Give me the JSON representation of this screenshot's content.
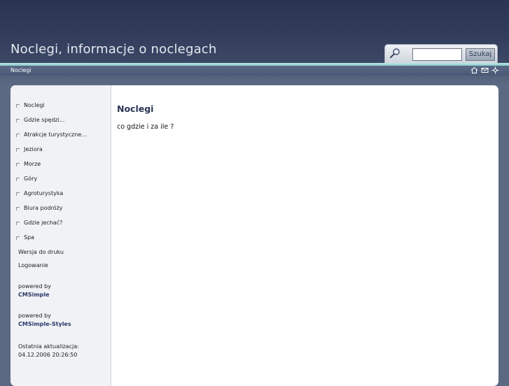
{
  "header": {
    "site_title": "Noclegi, informacje o noclegach",
    "search_placeholder": "",
    "search_button": "Szukaj"
  },
  "navbar": {
    "breadcrumb": "Noclegi",
    "icons": [
      "home-icon",
      "mail-icon",
      "sitemap-icon"
    ]
  },
  "sidebar": {
    "menu": [
      {
        "label": "Noclegi"
      },
      {
        "label": "Gdzie spędzi..."
      },
      {
        "label": "Atrakcje turystyczne..."
      },
      {
        "label": "Jeziora"
      },
      {
        "label": "Morze"
      },
      {
        "label": "Góry"
      },
      {
        "label": "Agroturystyka"
      },
      {
        "label": "Biura podróży"
      },
      {
        "label": "Gdzie jechać?"
      },
      {
        "label": "Spa"
      }
    ],
    "print_link": "Wersja do druku",
    "login_link": "Logowanie",
    "powered1_label": "powered by",
    "powered1_link": "CMSimple",
    "powered2_label": "powered by",
    "powered2_link": "CMSimple-Styles",
    "updated_label": "Ostatnia aktualizacja:",
    "updated_value": "04.12.2006 20:26:50"
  },
  "main": {
    "title": "Noclegi",
    "text": "co gdzie i za ile ?"
  },
  "colors": {
    "header_dark": "#2a3452",
    "teal_strip": "#86c9cc",
    "title_blue": "#2a3656",
    "link_blue": "#2a3a6b"
  }
}
